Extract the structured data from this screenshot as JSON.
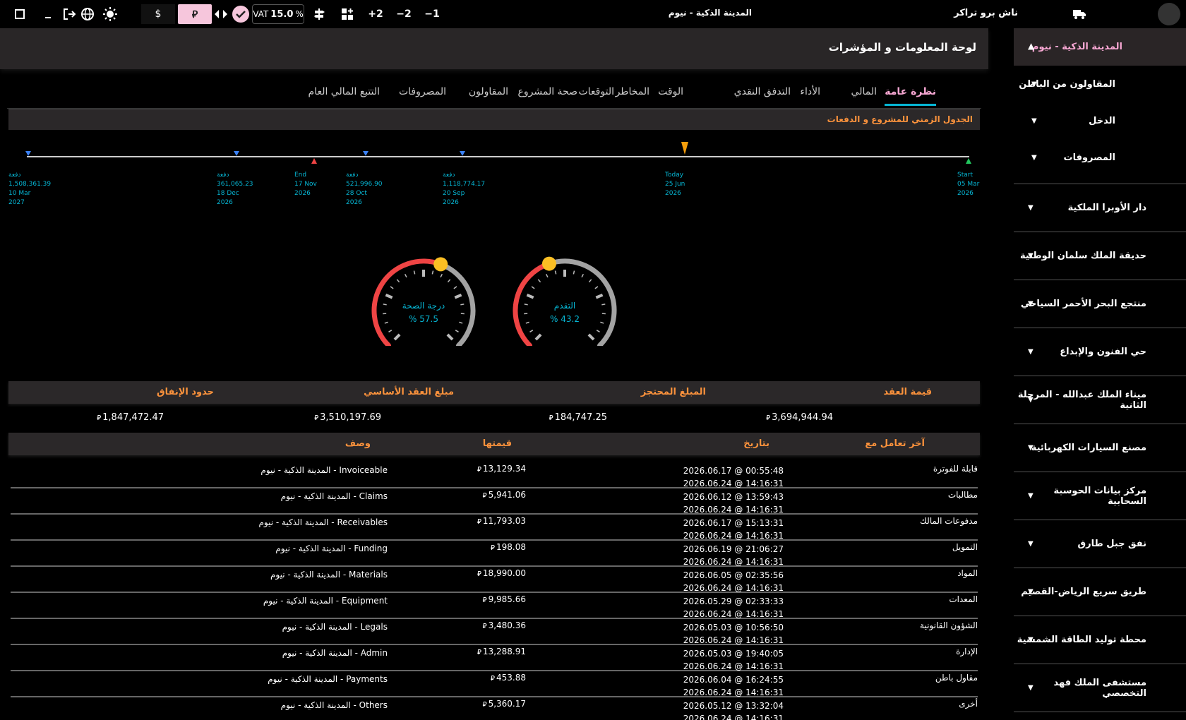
{
  "topbar": {
    "icons": [
      "square-icon",
      "minimize-icon",
      "logout-icon",
      "globe-icon",
      "sun-icon"
    ],
    "currency_usd": "$",
    "currency_sar": "⃁",
    "vat_label": "VAT",
    "vat_value": "15.0",
    "vat_unit": "%",
    "plus2": "+2",
    "minus2": "−2",
    "minus1": "−1",
    "project_title": "المدينة الذكية - نيوم",
    "app_name": "ناش برو تراكر"
  },
  "sidebar": {
    "active_project": "المدينة الذكية - نيوم",
    "sub_items": [
      "المقاولون من الباطن",
      "الدخل",
      "المصروفات"
    ],
    "projects": [
      "دار الأوبرا الملكية",
      "حديقة الملك سلمان الوطنية",
      "منتجع البحر الأحمر السياحي",
      "حي الفنون والإبداع",
      "ميناء الملك عبدالله - المرحلة الثانية",
      "مصنع السيارات الكهربائية",
      "مركز بيانات الحوسبة السحابية",
      "نفق جبل طارق",
      "طريق سريع الرياض-القصيم",
      "محطة توليد الطاقة الشمسية",
      "مستشفى الملك فهد التخصصي"
    ]
  },
  "main": {
    "title": "لوحة المعلومات و المؤشرات",
    "tabs": [
      "نظرة عامة",
      "المالي",
      "الأداء",
      "التدفق النقدي",
      "الوقت",
      "المخاطر",
      "التوقعات",
      "صحة المشروع",
      "المقاولون",
      "المصروفات",
      "التتبع المالي العام"
    ],
    "active_tab": 0
  },
  "timeline": {
    "header": "الجدول الزمني للمشروع و الدفعات",
    "markers": [
      {
        "kind": "payment",
        "lines": [
          "دفعة",
          "1,508,361.39",
          "10 Mar",
          "2027"
        ],
        "color": "#3b82f6"
      },
      {
        "kind": "payment",
        "lines": [
          "دفعة",
          "361,065.23",
          "18 Dec",
          "2026"
        ],
        "color": "#3b82f6"
      },
      {
        "kind": "end",
        "lines": [
          "End",
          "17 Nov",
          "2026"
        ],
        "color": "#ef4444"
      },
      {
        "kind": "payment",
        "lines": [
          "دفعة",
          "521,996.90",
          "28 Oct",
          "2026"
        ],
        "color": "#3b82f6"
      },
      {
        "kind": "payment",
        "lines": [
          "دفعة",
          "1,118,774.17",
          "20 Sep",
          "2026"
        ],
        "color": "#3b82f6"
      },
      {
        "kind": "today",
        "lines": [
          "Today",
          "25 Jun",
          "2026"
        ],
        "color": "#f59e0b"
      },
      {
        "kind": "start",
        "lines": [
          "Start",
          "05 Mar",
          "2026"
        ],
        "color": "#22c55e"
      }
    ]
  },
  "gauges": [
    {
      "label": "درجة الصحة",
      "value": "% 57.5",
      "fraction": 0.575
    },
    {
      "label": "التقدم",
      "value": "% 43.2",
      "fraction": 0.432
    }
  ],
  "kpis": [
    {
      "label": "قيمة العقد",
      "value": "3,694,944.94"
    },
    {
      "label": "المبلغ المحتجز",
      "value": "184,747.25"
    },
    {
      "label": "مبلغ العقد الأساسي",
      "value": "3,510,197.69"
    },
    {
      "label": "حدود الإنفاق",
      "value": "1,847,472.47"
    }
  ],
  "currency_symbol": "⃁",
  "table": {
    "headers": [
      "آخر تعامل مع",
      "بتاريخ",
      "قيمتها",
      "وصف"
    ],
    "rows": [
      {
        "name": "قابلة للفوترة",
        "d1": "2026.06.17 @ 00:55:48",
        "d2": "2026.06.24 @ 14:16:31",
        "amount": "13,129.34",
        "desc": "Invoiceable - المدينة الذكية - نيوم"
      },
      {
        "name": "مطالبات",
        "d1": "2026.06.12 @ 13:59:43",
        "d2": "2026.06.24 @ 14:16:31",
        "amount": "5,941.06",
        "desc": "Claims - المدينة الذكية - نيوم"
      },
      {
        "name": "مدفوعات المالك",
        "d1": "2026.06.17 @ 15:13:31",
        "d2": "2026.06.24 @ 14:16:31",
        "amount": "11,793.03",
        "desc": "Receivables - المدينة الذكية - نيوم"
      },
      {
        "name": "التمويل",
        "d1": "2026.06.19 @ 21:06:27",
        "d2": "2026.06.24 @ 14:16:31",
        "amount": "198.08",
        "desc": "Funding - المدينة الذكية - نيوم"
      },
      {
        "name": "المواد",
        "d1": "2026.06.05 @ 02:35:56",
        "d2": "2026.06.24 @ 14:16:31",
        "amount": "18,990.00",
        "desc": "Materials - المدينة الذكية - نيوم"
      },
      {
        "name": "المعدات",
        "d1": "2026.05.29 @ 02:33:33",
        "d2": "2026.06.24 @ 14:16:31",
        "amount": "9,985.66",
        "desc": "Equipment - المدينة الذكية - نيوم"
      },
      {
        "name": "الشؤون القانونية",
        "d1": "2026.05.03 @ 10:56:50",
        "d2": "2026.06.24 @ 14:16:31",
        "amount": "3,480.36",
        "desc": "Legals - المدينة الذكية - نيوم"
      },
      {
        "name": "الإدارة",
        "d1": "2026.05.03 @ 19:40:05",
        "d2": "2026.06.24 @ 14:16:31",
        "amount": "13,288.91",
        "desc": "Admin - المدينة الذكية - نيوم"
      },
      {
        "name": "مقاول باطن",
        "d1": "2026.06.04 @ 16:24:55",
        "d2": "2026.06.24 @ 14:16:31",
        "amount": "453.88",
        "desc": "Payments - المدينة الذكية - نيوم"
      },
      {
        "name": "أخرى",
        "d1": "2026.05.12 @ 13:32:04",
        "d2": "2026.06.24 @ 14:16:31",
        "amount": "5,360.17",
        "desc": "Others - المدينة الذكية - نيوم"
      }
    ]
  }
}
